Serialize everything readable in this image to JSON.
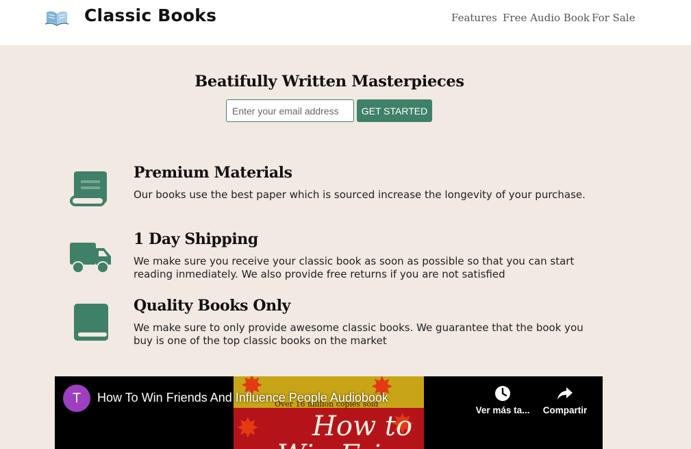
{
  "header": {
    "brand": "Classic Books",
    "logo_icon": "open-book-icon",
    "nav": [
      "Features",
      "Free Audio Book",
      "For Sale"
    ]
  },
  "hero": {
    "title": "Beatifully Written Masterpieces",
    "email_placeholder": "Enter your email address",
    "cta_label": "GET STARTED"
  },
  "features": [
    {
      "icon": "scroll-icon",
      "title": "Premium Materials",
      "text": "Our books use the best paper which is sourced increase the longevity of your purchase."
    },
    {
      "icon": "truck-icon",
      "title": "1 Day Shipping",
      "text": "We make sure you receive your classic book as soon as possible so that you can start reading inmediately. We also provide free returns if you are not satisfied"
    },
    {
      "icon": "book-icon",
      "title": "Quality Books Only",
      "text": "We make sure to only provide awesome classic books. We guarantee that the book you buy is one of the top classic books on the market"
    }
  ],
  "video": {
    "avatar_letter": "T",
    "title": "How To Win Friends And Influence People Audiobook",
    "cover_tagline": "Over 16 million copies sold",
    "cover_title_line1": "How to",
    "cover_title_line2": "Win Friends",
    "actions": [
      {
        "icon": "clock-icon",
        "label": "Ver más ta..."
      },
      {
        "icon": "share-icon",
        "label": "Compartir"
      }
    ]
  },
  "colors": {
    "accent": "#3f8068",
    "background": "#f1e9e2",
    "header_bg": "#ffffff",
    "avatar": "#9c3fc0"
  }
}
